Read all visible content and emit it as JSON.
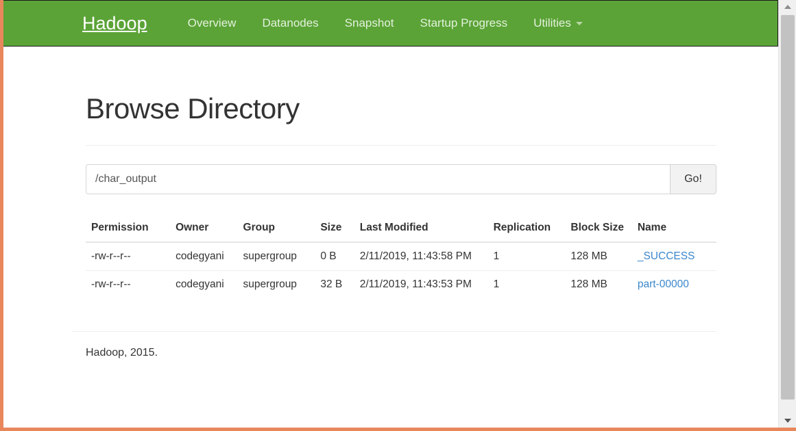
{
  "navbar": {
    "brand": "Hadoop",
    "links": [
      {
        "label": "Overview",
        "icon": ""
      },
      {
        "label": "Datanodes",
        "icon": ""
      },
      {
        "label": "Snapshot",
        "icon": ""
      },
      {
        "label": "Startup Progress",
        "icon": ""
      },
      {
        "label": "Utilities",
        "icon": "caret-down-icon"
      }
    ],
    "background_color": "#5ba337",
    "text_color": "#e4f1dc"
  },
  "page": {
    "title": "Browse Directory"
  },
  "path_form": {
    "value": "/char_output",
    "placeholder": "",
    "go_label": "Go!"
  },
  "table": {
    "headers": [
      "Permission",
      "Owner",
      "Group",
      "Size",
      "Last Modified",
      "Replication",
      "Block Size",
      "Name"
    ],
    "rows": [
      {
        "permission": "-rw-r--r--",
        "owner": "codegyani",
        "group": "supergroup",
        "size": "0 B",
        "last_modified": "2/11/2019, 11:43:58 PM",
        "replication": "1",
        "block_size": "128 MB",
        "name": "_SUCCESS"
      },
      {
        "permission": "-rw-r--r--",
        "owner": "codegyani",
        "group": "supergroup",
        "size": "32 B",
        "last_modified": "2/11/2019, 11:43:53 PM",
        "replication": "1",
        "block_size": "128 MB",
        "name": "part-00000"
      }
    ],
    "link_color": "#3a87cd"
  },
  "footer": {
    "text": "Hadoop, 2015."
  },
  "scrollbar": {
    "up_arrow": "triangle-up-icon",
    "down_arrow": "triangle-down-icon"
  },
  "frame": {
    "border_color": "#e8875c"
  }
}
